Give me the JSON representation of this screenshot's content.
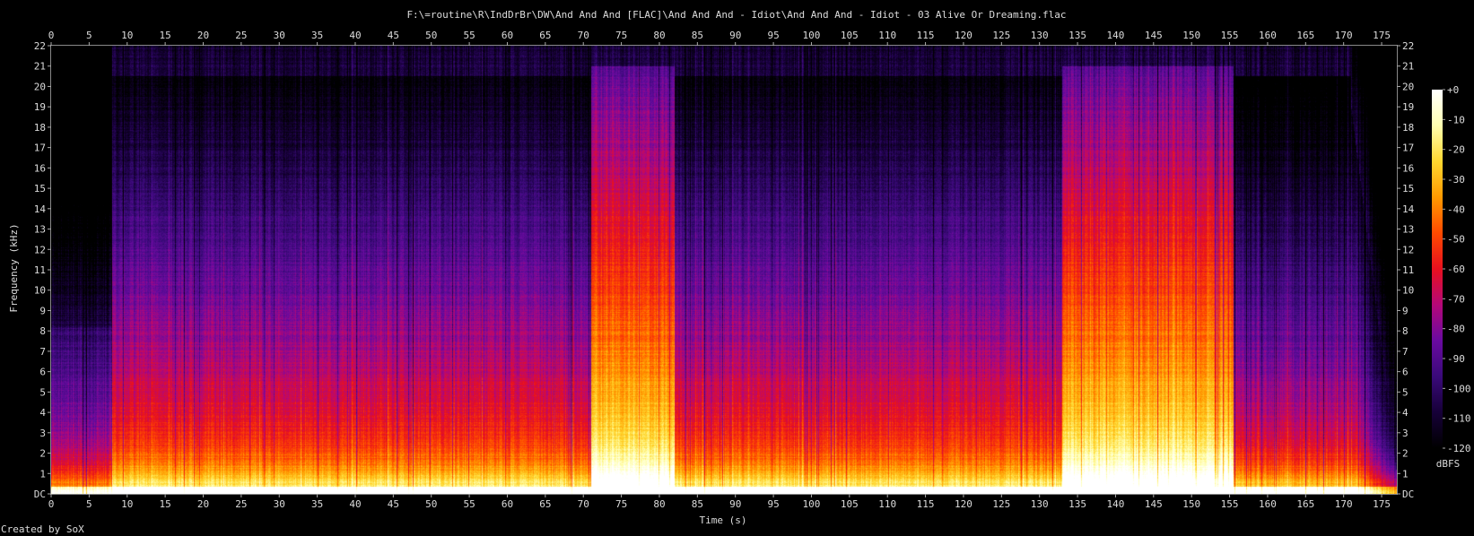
{
  "chart_data": {
    "type": "heatmap",
    "title": "F:\\=routine\\R\\IndDrBr\\DW\\And And And [FLAC]\\And And And - Idiot\\And And And - Idiot - 03 Alive Or Dreaming.flac",
    "xlabel": "Time (s)",
    "ylabel": "Frequency (kHz)",
    "xlim": [
      0,
      177
    ],
    "ylim": [
      0,
      22
    ],
    "x_ticks": [
      0,
      5,
      10,
      15,
      20,
      25,
      30,
      35,
      40,
      45,
      50,
      55,
      60,
      65,
      70,
      75,
      80,
      85,
      90,
      95,
      100,
      105,
      110,
      115,
      120,
      125,
      130,
      135,
      140,
      145,
      150,
      155,
      160,
      165,
      170,
      175
    ],
    "y_ticks": [
      "DC",
      "1",
      "2",
      "3",
      "4",
      "5",
      "6",
      "7",
      "8",
      "9",
      "10",
      "11",
      "12",
      "13",
      "14",
      "15",
      "16",
      "17",
      "18",
      "19",
      "20",
      "21",
      "22"
    ],
    "colorbar": {
      "label": "dBFS",
      "range": [
        -120,
        0
      ],
      "ticks": [
        "+0",
        "-10",
        "-20",
        "-30",
        "-40",
        "-50",
        "-60",
        "-70",
        "-80",
        "-90",
        "-100",
        "-110",
        "-120"
      ]
    },
    "segments": [
      {
        "start": 0,
        "end": 8,
        "energy": 0.4,
        "cutoff_khz": 8.2
      },
      {
        "start": 8,
        "end": 71,
        "energy": 0.58,
        "cutoff_khz": 20.5
      },
      {
        "start": 71,
        "end": 82,
        "energy": 0.86,
        "cutoff_khz": 21
      },
      {
        "start": 82,
        "end": 133,
        "energy": 0.58,
        "cutoff_khz": 20.5
      },
      {
        "start": 133,
        "end": 155.5,
        "energy": 0.86,
        "cutoff_khz": 21
      },
      {
        "start": 155.5,
        "end": 171,
        "energy": 0.5,
        "cutoff_khz": 20.5
      },
      {
        "start": 171,
        "end": 177,
        "energy": 0.15,
        "cutoff_khz": 6
      }
    ],
    "colors": {
      "background": "#000000",
      "palette": [
        "#000000",
        "#160038",
        "#3a0a7a",
        "#6a0aa0",
        "#b40878",
        "#e8101e",
        "#ff4a00",
        "#ff9a00",
        "#ffd830",
        "#ffffb0",
        "#ffffff"
      ]
    }
  },
  "footer": {
    "credit": "Created by SoX"
  }
}
